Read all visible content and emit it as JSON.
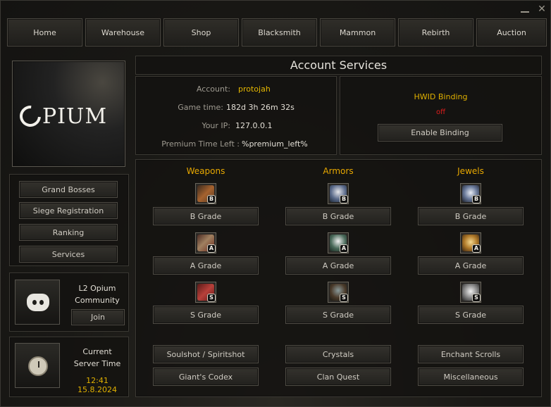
{
  "window": {
    "minimize_icon": "minimize-icon",
    "close_icon": "close-icon",
    "close_glyph": "✕"
  },
  "nav": [
    "Home",
    "Warehouse",
    "Shop",
    "Blacksmith",
    "Mammon",
    "Rebirth",
    "Auction"
  ],
  "logo": {
    "text": "PIUM"
  },
  "side_menu": [
    "Grand Bosses",
    "Siege Registration",
    "Ranking",
    "Services"
  ],
  "community": {
    "title_line1": "L2 Opium",
    "title_line2": "Community",
    "join_label": "Join",
    "icon": "discord-icon"
  },
  "server_time": {
    "line1": "Current",
    "line2": "Server Time",
    "value": "12:41 15.8.2024",
    "icon": "clock-icon"
  },
  "header": {
    "title": "Account Services"
  },
  "account": {
    "rows": [
      {
        "key": "Account:",
        "value": "protojah",
        "highlight": true
      },
      {
        "key": "Game time:",
        "value": "182d 3h 26m 32s",
        "highlight": false
      },
      {
        "key": "Your IP:",
        "value": "127.0.0.1",
        "highlight": false
      },
      {
        "key": "Premium Time Left :",
        "value": "%premium_left%",
        "highlight": false
      }
    ]
  },
  "hwid": {
    "title": "HWID Binding",
    "status": "off",
    "button": "Enable Binding"
  },
  "shop": {
    "columns": [
      {
        "title": "Weapons",
        "items": [
          {
            "grade": "B",
            "label": "B Grade",
            "icon": "sword-icon"
          },
          {
            "grade": "A",
            "label": "A Grade",
            "icon": "sword-icon"
          },
          {
            "grade": "S",
            "label": "S Grade",
            "icon": "sword-icon"
          }
        ]
      },
      {
        "title": "Armors",
        "items": [
          {
            "grade": "B",
            "label": "B Grade",
            "icon": "armor-icon"
          },
          {
            "grade": "A",
            "label": "A Grade",
            "icon": "armor-icon"
          },
          {
            "grade": "S",
            "label": "S Grade",
            "icon": "armor-icon"
          }
        ]
      },
      {
        "title": "Jewels",
        "items": [
          {
            "grade": "B",
            "label": "B Grade",
            "icon": "jewel-icon"
          },
          {
            "grade": "A",
            "label": "A Grade",
            "icon": "jewel-icon"
          },
          {
            "grade": "S",
            "label": "S Grade",
            "icon": "jewel-icon"
          }
        ]
      }
    ],
    "bottom_buttons": [
      "Soulshot / Spiritshot",
      "Crystals",
      "Enchant Scrolls",
      "Giant's Codex",
      "Clan Quest",
      "Miscellaneous"
    ]
  },
  "colors": {
    "accent": "#e0b000",
    "status_off": "#e01c1c"
  }
}
